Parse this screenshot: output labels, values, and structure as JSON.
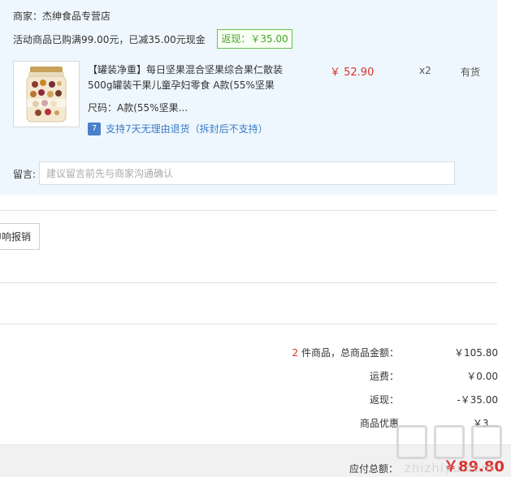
{
  "merchant": {
    "label": "商家：杰绅食品专营店"
  },
  "promo": {
    "text": "活动商品已购满99.00元，已减35.00元现金",
    "rebate": "返现：￥35.00"
  },
  "product": {
    "title_line1": "【罐装净重】每日坚果混合坚果综合果仁散装",
    "title_line2": "500g罐装干果儿童孕妇零食 A款(55%坚果",
    "spec": "尺码：A款(55%坚果...",
    "return_icon_char": "7",
    "return_policy": "支持7天无理由退货（拆封后不支持）",
    "price": "￥ 52.90",
    "quantity": "x2",
    "stock": "有货",
    "icon": "mixed-nuts-jar"
  },
  "message": {
    "label": "留言:",
    "placeholder": "建议留言前先与商家沟通确认"
  },
  "invoice": {
    "button_label": "申响报销"
  },
  "summary": {
    "count": "2",
    "count_suffix": " 件商品，总商品金额：",
    "total_value": "￥105.80",
    "shipping_label": "运费：",
    "shipping_value": "￥0.00",
    "rebate_label": "返现：",
    "rebate_value": "-￥35.00",
    "discount_label": "商品优惠",
    "discount_value": "￥3..."
  },
  "payment": {
    "label": "应付总额：",
    "amount": "￥89.80"
  },
  "watermark": {
    "text": "zhizhiyu.com"
  },
  "colors": {
    "accent_red": "#d9322e",
    "panel_bg": "#eef7fd",
    "rebate_green": "#4aa52e",
    "link_blue": "#3b7ac9"
  }
}
